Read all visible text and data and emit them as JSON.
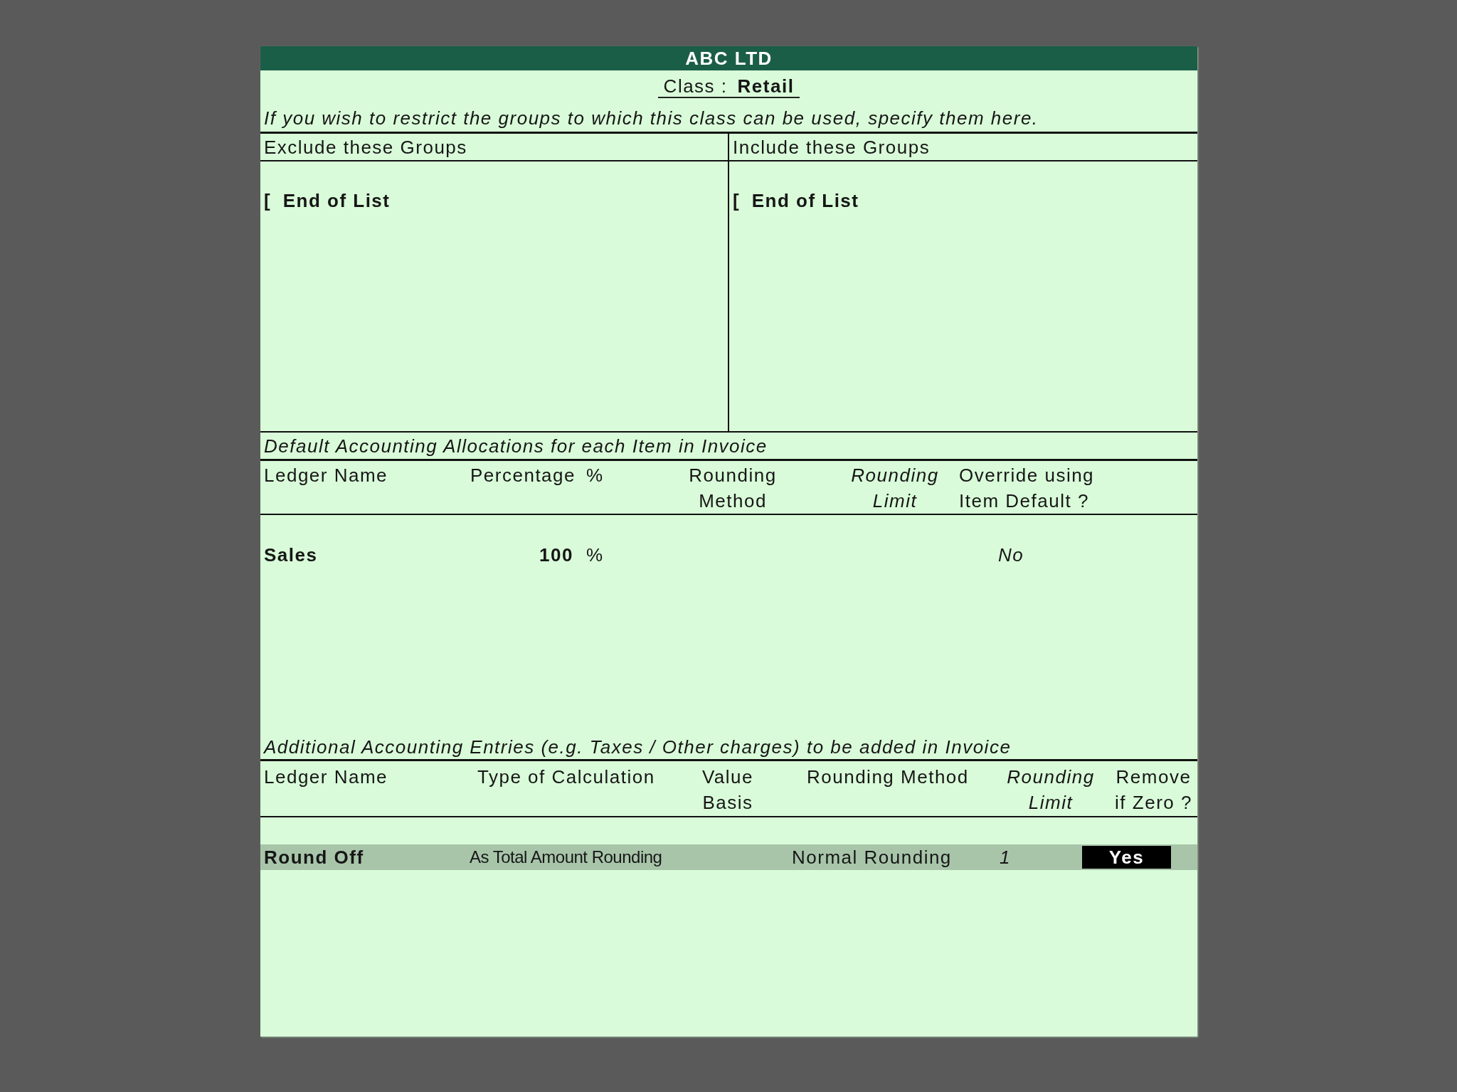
{
  "header": {
    "title": "ABC LTD"
  },
  "class": {
    "label": "Class :",
    "value": "Retail"
  },
  "instruction": "If you wish to restrict the groups to which this class can be used, specify them here.",
  "group_lists": [
    {
      "heading": "Exclude these Groups",
      "items": [
        {
          "marker": "[",
          "label": "End of List"
        }
      ]
    },
    {
      "heading": "Include these Groups",
      "items": [
        {
          "marker": "[",
          "label": "End of List"
        }
      ]
    }
  ],
  "allocations": {
    "title": "Default Accounting Allocations for each Item in Invoice",
    "columns": [
      {
        "lines": [
          "Ledger Name"
        ],
        "italic": false
      },
      {
        "lines": [
          "Percentage"
        ],
        "italic": false
      },
      {
        "lines": [
          "%"
        ],
        "italic": false
      },
      {
        "lines": [
          "Rounding",
          "Method"
        ],
        "italic": false
      },
      {
        "lines": [
          "Rounding",
          "Limit"
        ],
        "italic": true
      },
      {
        "lines": [
          "Override using",
          "Item Default ?"
        ],
        "italic": false
      }
    ],
    "rows": [
      {
        "ledger_name": "Sales",
        "percentage": "100",
        "percent_sign": "%",
        "override_using_item_default": "No"
      }
    ]
  },
  "additional_entries": {
    "title": "Additional Accounting Entries (e.g. Taxes / Other charges) to be added in Invoice",
    "columns": [
      {
        "lines": [
          "Ledger Name"
        ],
        "italic": false
      },
      {
        "lines": [
          "Type of Calculation"
        ],
        "italic": false
      },
      {
        "lines": [
          "Value",
          "Basis"
        ],
        "italic": false
      },
      {
        "lines": [
          "Rounding Method"
        ],
        "italic": false
      },
      {
        "lines": [
          "Rounding",
          "Limit"
        ],
        "italic": true
      },
      {
        "lines": [
          "Remove",
          "if Zero ?"
        ],
        "italic": false
      }
    ],
    "rows": [
      {
        "ledger_name": "Round Off",
        "type_of_calculation": "As Total Amount Rounding",
        "rounding_method": "Normal Rounding",
        "rounding_limit": "1",
        "remove_if_zero": "Yes",
        "selected": true,
        "remove_if_zero_focused": true
      }
    ]
  }
}
